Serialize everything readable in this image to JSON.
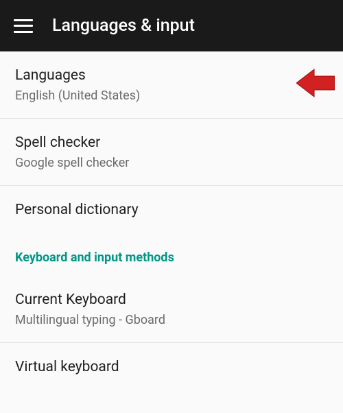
{
  "appbar": {
    "title": "Languages & input"
  },
  "items": {
    "languages": {
      "title": "Languages",
      "subtitle": "English (United States)"
    },
    "spell_checker": {
      "title": "Spell checker",
      "subtitle": "Google spell checker"
    },
    "personal_dictionary": {
      "title": "Personal dictionary"
    },
    "current_keyboard": {
      "title": "Current Keyboard",
      "subtitle": "Multilingual typing - Gboard"
    },
    "virtual_keyboard": {
      "title": "Virtual keyboard"
    }
  },
  "section": {
    "keyboard_header": "Keyboard and input methods"
  }
}
